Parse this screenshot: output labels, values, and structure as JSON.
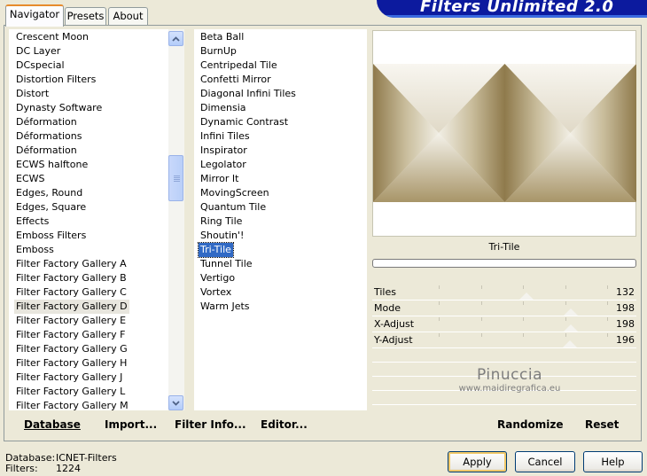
{
  "app_title": "Filters Unlimited 2.0",
  "tabs": [
    "Navigator",
    "Presets",
    "About"
  ],
  "categories": [
    "Crescent Moon",
    "DC Layer",
    "DCspecial",
    "Distortion Filters",
    "Distort",
    "Dynasty Software",
    "Déformation",
    "Déformations",
    "Déformation",
    "ECWS halftone",
    "ECWS",
    "Edges, Round",
    "Edges, Square",
    "Effects",
    "Emboss Filters",
    "Emboss",
    "Filter Factory Gallery A",
    "Filter Factory Gallery B",
    "Filter Factory Gallery C",
    "Filter Factory Gallery D",
    "Filter Factory Gallery E",
    "Filter Factory Gallery F",
    "Filter Factory Gallery G",
    "Filter Factory Gallery H",
    "Filter Factory Gallery J",
    "Filter Factory Gallery L",
    "Filter Factory Gallery M"
  ],
  "highlighted_category": "Filter Factory Gallery D",
  "filters": [
    "Beta Ball",
    "BurnUp",
    "Centripedal Tile",
    "Confetti Mirror",
    "Diagonal Infini Tiles",
    "Dimensia",
    "Dynamic Contrast",
    "Infini Tiles",
    "Inspirator",
    "Legolator",
    "Mirror It",
    "MovingScreen",
    "Quantum Tile",
    "Ring Tile",
    "Shoutin'!",
    "Tri-Tile",
    "Tunnel Tile",
    "Vertigo",
    "Vortex",
    "Warm Jets"
  ],
  "selected_filter": "Tri-Tile",
  "bottom_links": {
    "database": "Database",
    "import": "Import...",
    "filter_info": "Filter Info...",
    "editor": "Editor...",
    "randomize": "Randomize",
    "reset": "Reset"
  },
  "filter_title": "Tri-Tile",
  "params": [
    {
      "label": "Tiles",
      "value": "132",
      "level": 132
    },
    {
      "label": "Mode",
      "value": "198",
      "level": 198
    },
    {
      "label": "X-Adjust",
      "value": "198",
      "level": 198
    },
    {
      "label": "Y-Adjust",
      "value": "196",
      "level": 196
    }
  ],
  "watermark": {
    "name": "Pinuccia",
    "url": "www.maidiregrafica.eu"
  },
  "info": {
    "database_label": "Database:",
    "database_value": "ICNET-Filters",
    "filters_label": "Filters:",
    "filters_value": "1224"
  },
  "buttons": {
    "apply": "Apply",
    "cancel": "Cancel",
    "help": "Help"
  },
  "colors": {
    "selection": "#316ac5",
    "header_band": "#0c1a9e",
    "active_tab_accent": "#e68b2c",
    "preview_dark": "#9a8659",
    "preview_light": "#f4f2ea"
  },
  "icons": {
    "scroll_up": "chevron-up-icon",
    "scroll_down": "chevron-down-icon",
    "scroll_grip": "grip-icon"
  }
}
